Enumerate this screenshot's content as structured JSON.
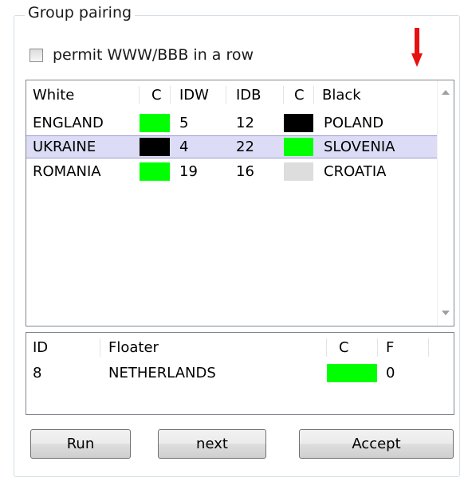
{
  "group": {
    "title": "Group pairing"
  },
  "permit": {
    "label": "permit WWW/BBB in a row",
    "checked": false
  },
  "pairing_table": {
    "headers": [
      "White",
      "C",
      "IDW",
      "IDB",
      "C",
      "Black"
    ],
    "rows": [
      {
        "white": "ENGLAND",
        "white_color": "#00ff00",
        "idw": "5",
        "idb": "12",
        "black_color": "#000000",
        "black": "POLAND",
        "selected": false
      },
      {
        "white": "UKRAINE",
        "white_color": "#000000",
        "idw": "4",
        "idb": "22",
        "black_color": "#00ff00",
        "black": "SLOVENIA",
        "selected": true
      },
      {
        "white": "ROMANIA",
        "white_color": "#00ff00",
        "idw": "19",
        "idb": "16",
        "black_color": "#dddddd",
        "black": "CROATIA",
        "selected": false
      }
    ]
  },
  "floater_table": {
    "headers": [
      "ID",
      "Floater",
      "C",
      "F"
    ],
    "rows": [
      {
        "id": "8",
        "floater": "NETHERLANDS",
        "color": "#00ff00",
        "f": "0"
      }
    ]
  },
  "buttons": {
    "run": "Run",
    "next": "next",
    "accept": "Accept"
  },
  "colors": {
    "selected_row": "#dcdcf6",
    "indicator_arrow": "#e81010",
    "green_swatch": "#00ff00"
  },
  "icons": {
    "indicator": "red-down-arrow-icon",
    "scroll_up": "scroll-up-arrow-icon",
    "scroll_down": "scroll-down-arrow-icon"
  }
}
